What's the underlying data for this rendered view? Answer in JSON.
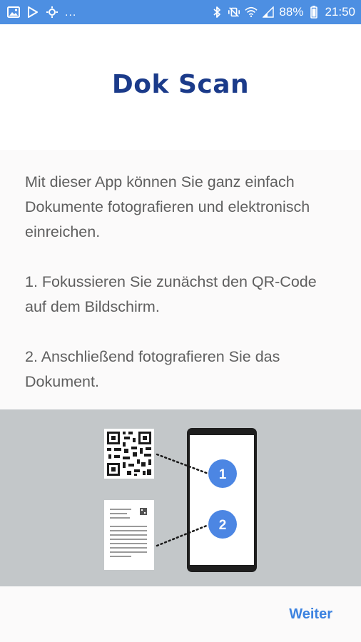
{
  "status_bar": {
    "notification_icons": [
      "image-icon",
      "play-store-icon",
      "settings-sync-icon"
    ],
    "overflow": "...",
    "battery": "88%",
    "time": "21:50",
    "bar_color": "#4d8fe2"
  },
  "header": {
    "title": "Dok Scan",
    "title_color": "#1b3b8a"
  },
  "intro": {
    "paragraph_1": "Mit dieser App können Sie ganz einfach Dokumente fotografieren und elektronisch einreichen.",
    "step_1": "1. Fokussieren Sie zunächst den QR-Code auf dem Bildschirm.",
    "step_2": "2. Anschließend fotografieren Sie das Dokument."
  },
  "illustration": {
    "marker_1": "1",
    "marker_2": "2",
    "marker_color": "#4c86e3"
  },
  "footer": {
    "next_label": "Weiter",
    "accent_color": "#3b82e0"
  }
}
